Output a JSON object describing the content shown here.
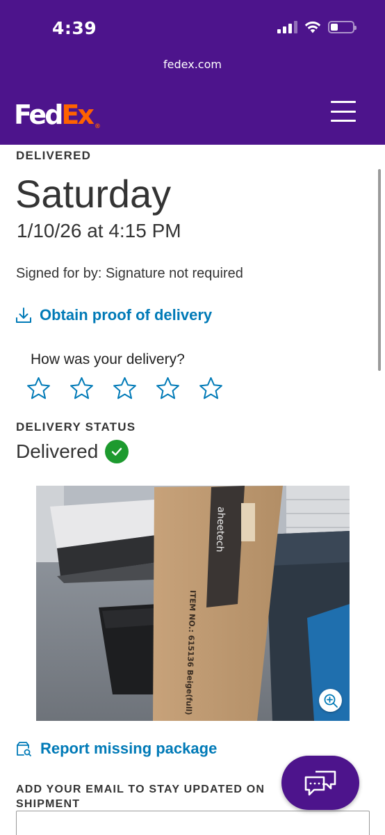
{
  "status_bar": {
    "time": "4:39"
  },
  "browser": {
    "url": "fedex.com"
  },
  "header": {
    "logo_fed": "Fed",
    "logo_ex": "Ex",
    "logo_reg": "®",
    "brand_purple": "#4d148c",
    "brand_orange": "#ff6200"
  },
  "delivery": {
    "eyebrow": "DELIVERED",
    "day": "Saturday",
    "date_time": "1/10/26 at 4:15 PM",
    "signed_for": "Signed for by: Signature not required",
    "proof_link": "Obtain proof of delivery",
    "rating_question": "How was your delivery?",
    "rating_stars_total": 5,
    "rating_value": 0,
    "status_heading": "DELIVERY STATUS",
    "status_value": "Delivered",
    "link_color": "#007ab7",
    "success_color": "#1d9a2e"
  },
  "photo": {
    "box_brand": "aheetech",
    "box_item": "ITEM NO.: 615136 Beige(full)"
  },
  "actions": {
    "report_link": "Report missing package",
    "email_heading": "ADD YOUR EMAIL TO STAY UPDATED ON SHIPMENT",
    "email_value": ""
  },
  "icons": {
    "download": "download-icon",
    "star": "star-outline-icon",
    "check": "check-circle-icon",
    "zoom": "zoom-in-icon",
    "report": "package-search-icon",
    "chat": "chat-bubbles-icon",
    "menu": "hamburger-menu-icon"
  }
}
